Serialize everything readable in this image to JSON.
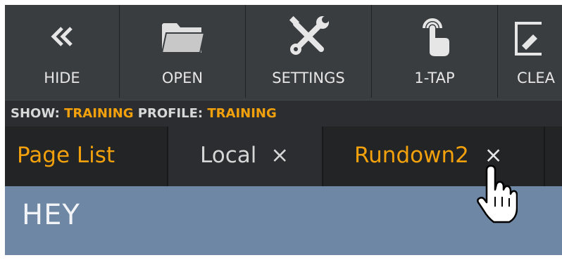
{
  "toolbar": {
    "buttons": [
      {
        "label": "HIDE",
        "icon": "double-chevron-left-icon"
      },
      {
        "label": "OPEN",
        "icon": "folder-icon"
      },
      {
        "label": "SETTINGS",
        "icon": "wrench-screwdriver-icon"
      },
      {
        "label": "1-TAP",
        "icon": "tap-hand-icon"
      },
      {
        "label": "CLEA",
        "icon": "clear-icon"
      }
    ]
  },
  "status": {
    "show_label": "SHOW:",
    "show_value": "TRAINING",
    "profile_label": "PROFILE:",
    "profile_value": "TRAINING"
  },
  "tabs": [
    {
      "label": "Page List",
      "closable": false
    },
    {
      "label": "Local",
      "closable": true,
      "close": "×"
    },
    {
      "label": "Rundown2",
      "closable": true,
      "close": "×"
    }
  ],
  "content": {
    "title": "HEY"
  },
  "colors": {
    "accent": "#f2a10c",
    "toolbar_bg": "#3a3d40",
    "tab_bg": "#222426",
    "content_bg": "#6e87a5"
  }
}
